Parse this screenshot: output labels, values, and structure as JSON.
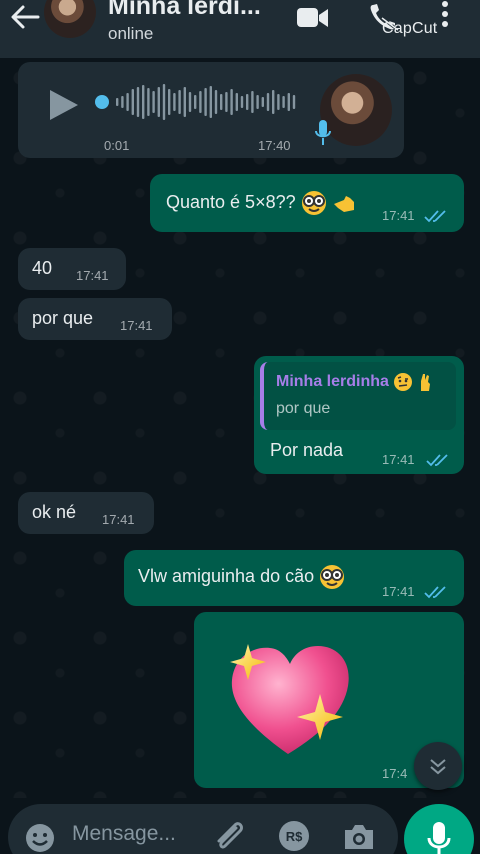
{
  "header": {
    "contact_name": "Minha lerdi...",
    "status": "online",
    "watermark": "CapCut",
    "background": "#1f2c34"
  },
  "voice_message": {
    "duration": "0:01",
    "time": "17:40",
    "progress": 0
  },
  "messages": [
    {
      "direction": "out",
      "text": "Quanto é 5×8??",
      "emojis": [
        "nerd-face",
        "backhand-index-pointing-left"
      ],
      "time": "17:41",
      "status": "read"
    },
    {
      "direction": "in",
      "text": "40",
      "time": "17:41"
    },
    {
      "direction": "in",
      "text": "por que",
      "time": "17:41"
    },
    {
      "direction": "out",
      "text": "Por nada",
      "time": "17:41",
      "status": "read",
      "reply_to": {
        "name": "Minha lerdinha",
        "emojis": [
          "face-with-raised-eyebrow",
          "crossed-fingers"
        ],
        "text": "por que"
      }
    },
    {
      "direction": "in",
      "text": "ok né",
      "time": "17:41"
    },
    {
      "direction": "out",
      "text": "Vlw amiguinha do cão",
      "emojis": [
        "nerd-face"
      ],
      "time": "17:41",
      "status": "read"
    },
    {
      "direction": "out",
      "sticker": "sparkling-heart",
      "time": "17:4"
    }
  ],
  "composer": {
    "placeholder": "Mensage..."
  },
  "colors": {
    "chat_bg": "#0b141a",
    "incoming_bubble": "#1f2c34",
    "outgoing_bubble": "#005c4b",
    "read_ticks": "#53bdeb",
    "accent": "#00a884",
    "quote_name": "#a67ee8"
  }
}
